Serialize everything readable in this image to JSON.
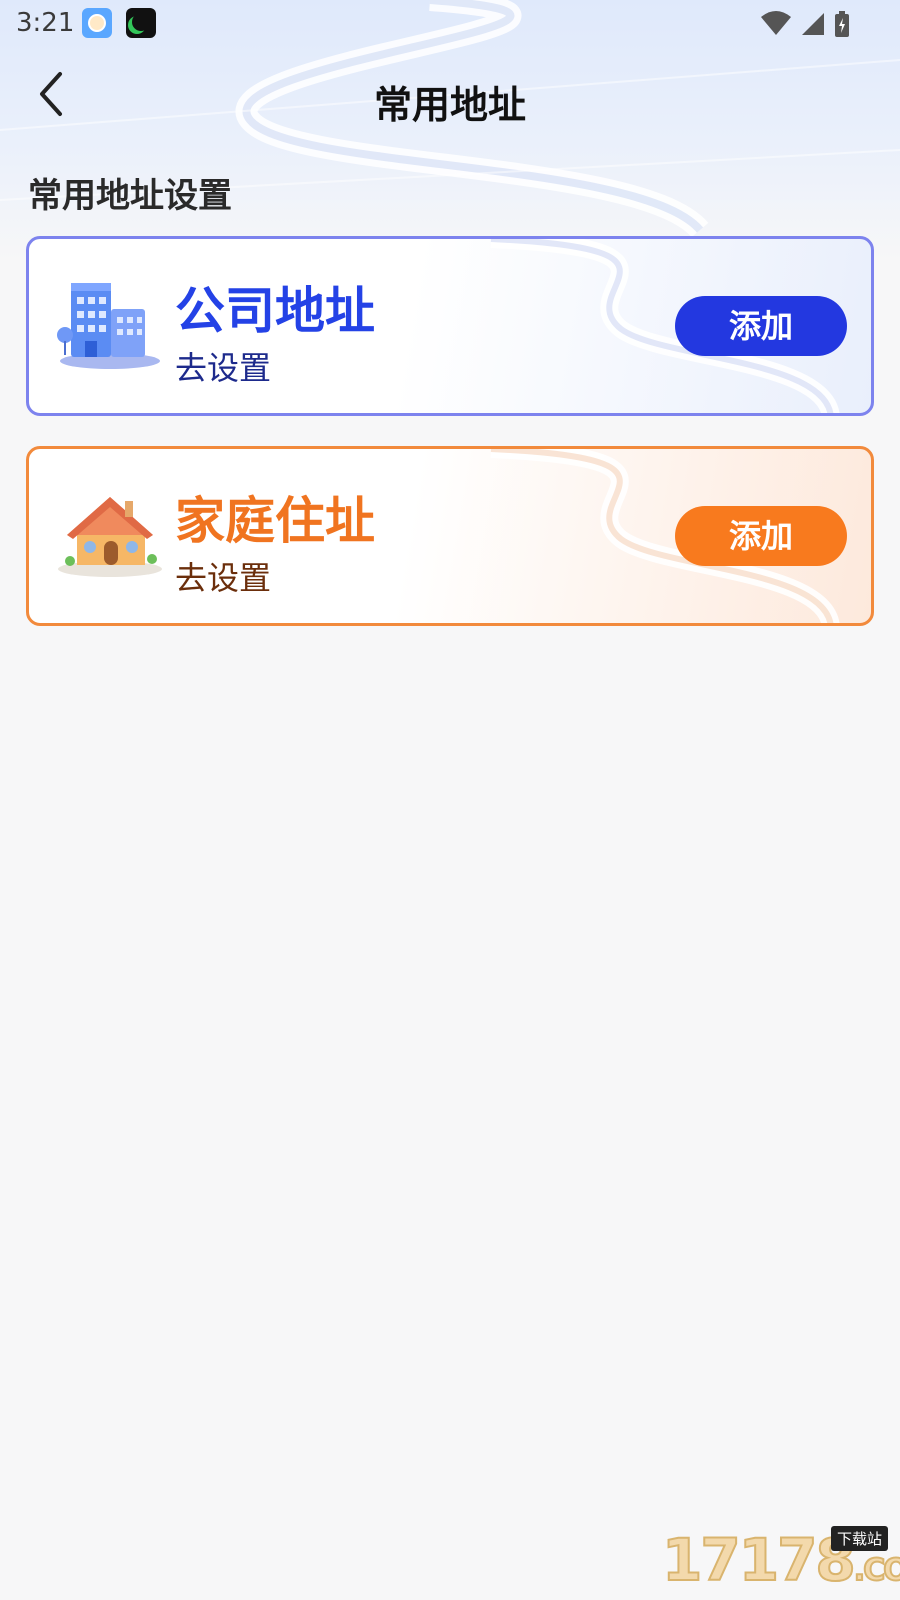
{
  "status_bar": {
    "time": "3:21"
  },
  "nav": {
    "title": "常用地址"
  },
  "section": {
    "title": "常用地址设置"
  },
  "cards": [
    {
      "id": "company",
      "title": "公司地址",
      "subtitle": "去设置",
      "button_label": "添加",
      "accent": "#2338e0",
      "border": "#7d83ee",
      "icon": "office-building-icon"
    },
    {
      "id": "home",
      "title": "家庭住址",
      "subtitle": "去设置",
      "button_label": "添加",
      "accent": "#f87a1e",
      "border": "#f28a3c",
      "icon": "house-icon"
    }
  ],
  "watermark": {
    "text": "17178",
    "suffix": ".COM",
    "badge": "下载站"
  }
}
